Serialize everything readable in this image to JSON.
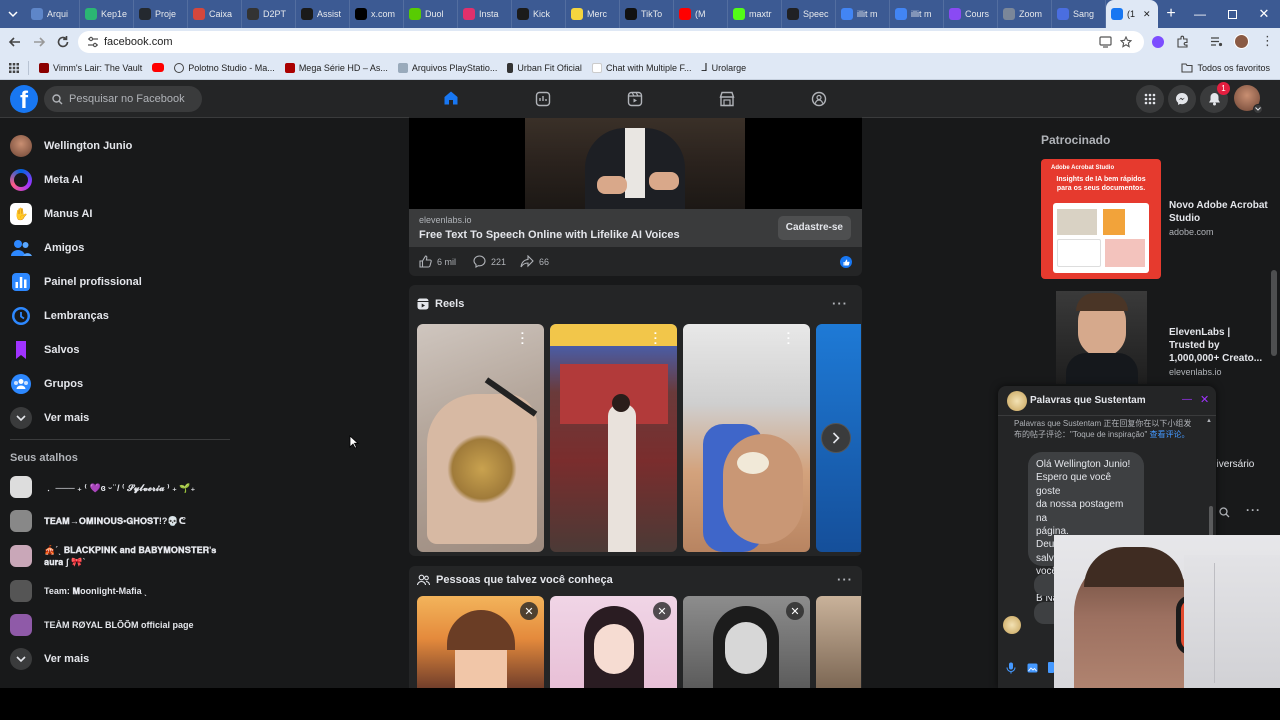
{
  "browser": {
    "tabs": [
      {
        "label": "Arqui",
        "color": "#5e86c9"
      },
      {
        "label": "Kep1e",
        "color": "#2bb673"
      },
      {
        "label": "Proje",
        "color": "#24292f"
      },
      {
        "label": "Caixa",
        "color": "#d4473c"
      },
      {
        "label": "D2PT",
        "color": "#333333"
      },
      {
        "label": "Assist",
        "color": "#1a1a1a"
      },
      {
        "label": "x.com",
        "color": "#000000"
      },
      {
        "label": "Duol",
        "color": "#58cc02"
      },
      {
        "label": "Insta",
        "color": "#e1306c"
      },
      {
        "label": "Kick",
        "color": "#1b1b1b"
      },
      {
        "label": "Merc",
        "color": "#f5d53f"
      },
      {
        "label": "TikTo",
        "color": "#111111"
      },
      {
        "label": "(M",
        "color": "#ff0000"
      },
      {
        "label": "maxtr",
        "color": "#53fc18"
      },
      {
        "label": "Speec",
        "color": "#202124"
      },
      {
        "label": "illit m",
        "color": "#4285f4"
      },
      {
        "label": "illit m",
        "color": "#4285f4"
      },
      {
        "label": "Cours",
        "color": "#8a4af3"
      },
      {
        "label": "Zoom",
        "color": "#7b8799"
      },
      {
        "label": "Sang",
        "color": "#4a6ee0"
      },
      {
        "label": "(1",
        "color": "#1877f2"
      }
    ],
    "url": "facebook.com",
    "bookmarks": [
      "Vimm's Lair: The Vault",
      "Polotno Studio - Ma...",
      "Mega Série HD – As...",
      "Arquivos PlayStatio...",
      "Urban Fit Oficial",
      "Chat with Multiple F...",
      "Urolarge"
    ],
    "all_bookmarks": "Todos os favoritos",
    "notif_count": "1"
  },
  "topbar": {
    "search_placeholder": "Pesquisar no Facebook"
  },
  "sidebar": {
    "items": [
      {
        "label": "Wellington Junio",
        "icon": "profile-avatar"
      },
      {
        "label": "Meta AI",
        "icon": "meta-ai-icon"
      },
      {
        "label": "Manus AI",
        "icon": "manus-icon"
      },
      {
        "label": "Amigos",
        "icon": "friends-icon"
      },
      {
        "label": "Painel profissional",
        "icon": "dashboard-icon"
      },
      {
        "label": "Lembranças",
        "icon": "memories-icon"
      },
      {
        "label": "Salvos",
        "icon": "saved-icon"
      },
      {
        "label": "Grupos",
        "icon": "groups-icon"
      },
      {
        "label": "Ver mais",
        "icon": "chevron-down-icon"
      }
    ],
    "shortcuts_title": "Seus atalhos",
    "shortcuts": [
      "﹒ ─── ₊ ⁽ 💜ɞ ᵕ ̈ / ⁽ 𝓢𝔂𝓵𝓿𝓮𝓻𝓲𝓪 ⁾ ₊ 🌱₊",
      "𝐓𝐄𝐀𝐌→𝐎𝐌𝐈𝐍𝐎𝐔𝐒•𝐆𝐇𝐎𝐒𝐓!?💀ᕦ",
      "🎪ˊˎ 𝐁𝐋𝐀𝐂𝐊𝐏𝐈𝐍𝐊 𝐚𝐧𝐝 𝐁𝐀𝐁𝐘𝐌𝐎𝐍𝐒𝐓𝐄𝐑'𝐬 𝐚𝐮𝐫𝐚 ʃ 🎀ˋ",
      "Team: 𝐌oonlight-Mafia ˎ",
      "TEÀM RØYAL BLÕÕM official page"
    ],
    "shortcuts_more": "Ver mais"
  },
  "feed": {
    "ad": {
      "domain": "elevenlabs.io",
      "title": "Free Text To Speech Online with Lifelike AI Voices",
      "cta": "Cadastre-se",
      "likes": "6 mil",
      "comments": "221",
      "shares": "66"
    },
    "reels_title": "Reels",
    "people_title": "Pessoas que talvez você conheça"
  },
  "right": {
    "sponsored_title": "Patrocinado",
    "ads": [
      {
        "title": "Novo Adobe Acrobat Studio",
        "domain": "adobe.com",
        "brand": "Adobe Acrobat Studio",
        "headline": "Insights de IA bem rápidos para os seus documentos."
      },
      {
        "title": "ElevenLabs | Trusted by 1,000,000+ Creato...",
        "domain": "elevenlabs.io"
      }
    ],
    "partial_text": "niversário"
  },
  "chat": {
    "name": "Palavras que Sustentam",
    "notice": "Palavras que Sustentam 正在回复你在以下小组发布的帖子评论：\"Toque de inspiração\"",
    "notice_link": "查看评论。",
    "message": [
      "Olá Wellington Junio!",
      "Espero que você goste",
      "da nossa postagem na",
      "página.",
      "Deus está te salvando,",
      "você ama Deus?",
      "💜A",
      "B Na"
    ]
  },
  "colors": {
    "fb_blue": "#1877f2",
    "bg": "#18191a",
    "card": "#242526",
    "text": "#e4e6eb",
    "muted": "#b0b3b8"
  }
}
